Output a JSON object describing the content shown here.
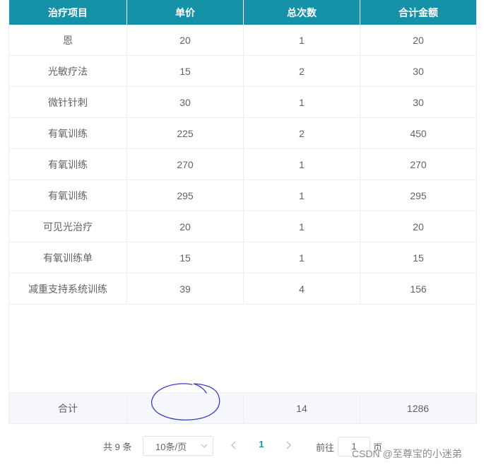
{
  "table": {
    "headers": [
      "治疗项目",
      "单价",
      "总次数",
      "合计金额"
    ],
    "rows": [
      [
        "恩",
        "20",
        "1",
        "20"
      ],
      [
        "光敏疗法",
        "15",
        "2",
        "30"
      ],
      [
        "微针针刺",
        "30",
        "1",
        "30"
      ],
      [
        "有氧训练",
        "225",
        "2",
        "450"
      ],
      [
        "有氧训练",
        "270",
        "1",
        "270"
      ],
      [
        "有氧训练",
        "295",
        "1",
        "295"
      ],
      [
        "可见光治疗",
        "20",
        "1",
        "20"
      ],
      [
        "有氧训练单",
        "15",
        "1",
        "15"
      ],
      [
        "减重支持系统训练",
        "39",
        "4",
        "156"
      ]
    ],
    "footer": [
      "合计",
      "",
      "14",
      "1286"
    ]
  },
  "pagination": {
    "total_text": "共 9 条",
    "page_size": "10条/页",
    "current_page": "1",
    "goto_prefix": "前往",
    "goto_value": "1",
    "goto_suffix": "页"
  },
  "watermark": "CSDN @至尊宝的小迷弟",
  "colors": {
    "header_bg": "#1591a8",
    "active_page": "#1591a8",
    "annotation": "#3a3fc7"
  },
  "icons": {
    "prev": "chevron-left-icon",
    "next": "chevron-right-icon",
    "dropdown": "chevron-down-icon"
  }
}
